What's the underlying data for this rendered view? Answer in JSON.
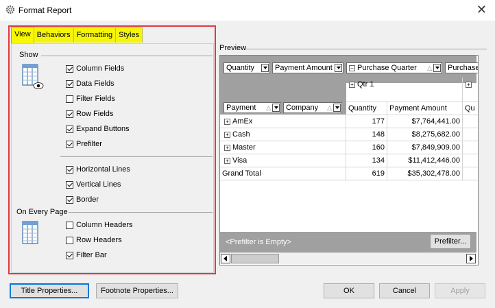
{
  "window": {
    "title": "Format Report",
    "close_glyph": "✕"
  },
  "tabs": [
    {
      "label": "View",
      "active": true
    },
    {
      "label": "Behaviors",
      "active": false
    },
    {
      "label": "Formatting",
      "active": false
    },
    {
      "label": "Styles",
      "active": false
    }
  ],
  "view": {
    "show_group": "Show",
    "show_checkboxes": [
      {
        "label": "Column Fields",
        "checked": true
      },
      {
        "label": "Data Fields",
        "checked": true
      },
      {
        "label": "Filter Fields",
        "checked": false
      },
      {
        "label": "Row Fields",
        "checked": true
      },
      {
        "label": "Expand Buttons",
        "checked": true
      },
      {
        "label": "Prefilter",
        "checked": true
      }
    ],
    "line_checkboxes": [
      {
        "label": "Horizontal Lines",
        "checked": true
      },
      {
        "label": "Vertical Lines",
        "checked": true
      },
      {
        "label": "Border",
        "checked": true
      }
    ],
    "every_page_group": "On Every Page",
    "page_checkboxes": [
      {
        "label": "Column Headers",
        "checked": false
      },
      {
        "label": "Row Headers",
        "checked": false
      },
      {
        "label": "Filter Bar",
        "checked": true
      }
    ]
  },
  "preview": {
    "label": "Preview",
    "data_fields": [
      "Quantity",
      "Payment Amount"
    ],
    "column_field": "Purchase Quarter",
    "column_field_cut": "Purchase",
    "row_fields": [
      "Payment",
      "Company"
    ],
    "qtr_header": "Qtr 1",
    "col_headers": [
      "Quantity",
      "Payment Amount",
      "Qu"
    ],
    "rows": [
      {
        "label": "AmEx",
        "quantity": "177",
        "amount": "$7,764,441.00"
      },
      {
        "label": "Cash",
        "quantity": "148",
        "amount": "$8,275,682.00"
      },
      {
        "label": "Master",
        "quantity": "160",
        "amount": "$7,849,909.00"
      },
      {
        "label": "Visa",
        "quantity": "134",
        "amount": "$11,412,446.00"
      }
    ],
    "grand_total": {
      "label": "Grand Total",
      "quantity": "619",
      "amount": "$35,302,478.00"
    },
    "prefilter_text": "<Prefilter is Empty>",
    "prefilter_button": "Prefilter..."
  },
  "buttons": {
    "title_properties": "Title Properties...",
    "footnote_properties": "Footnote Properties...",
    "ok": "OK",
    "cancel": "Cancel",
    "apply": "Apply"
  }
}
